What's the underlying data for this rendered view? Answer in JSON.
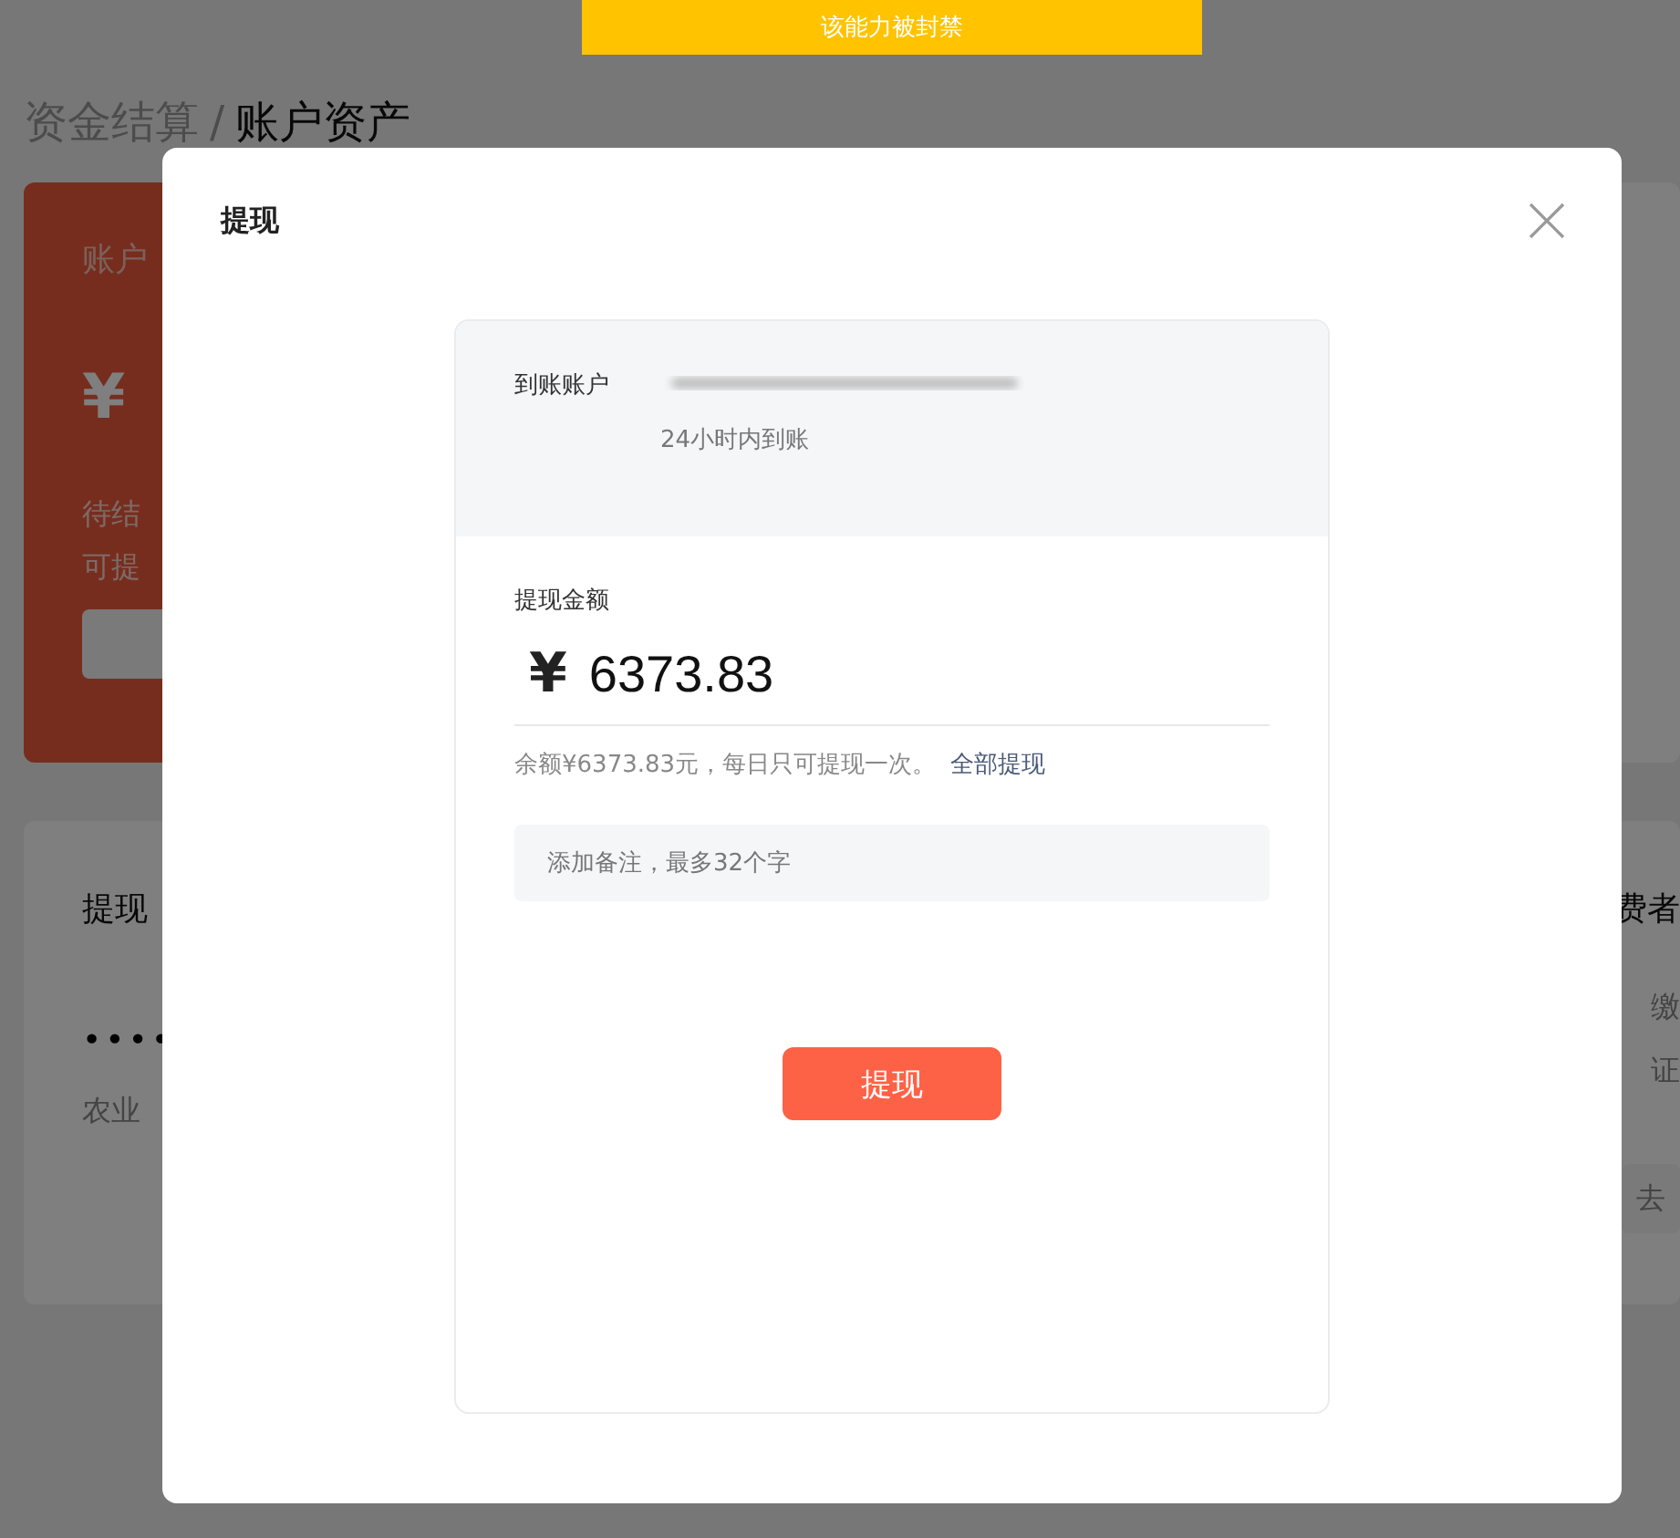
{
  "banner": "该能力被封禁",
  "breadcrumb": {
    "parent": "资金结算",
    "separator": "/",
    "current": "账户资产"
  },
  "balance_card": {
    "title": "账户",
    "amount": "¥",
    "lines": [
      "待结",
      "可提"
    ]
  },
  "withdraw_card": {
    "title": "提现",
    "masked": "••••",
    "bank": "农业"
  },
  "deposit_card": {
    "title": "费者",
    "lines": [
      "缴",
      "证"
    ],
    "button": "去"
  },
  "dialog": {
    "title": "提现",
    "account_label": "到账账户",
    "arrival": "24小时内到账",
    "amount_label": "提现金额",
    "currency": "¥",
    "amount": "6373.83",
    "note": "余额¥6373.83元，每日只可提现一次。",
    "withdraw_all": "全部提现",
    "remark_placeholder": "添加备注，最多32个字",
    "submit": "提现"
  }
}
